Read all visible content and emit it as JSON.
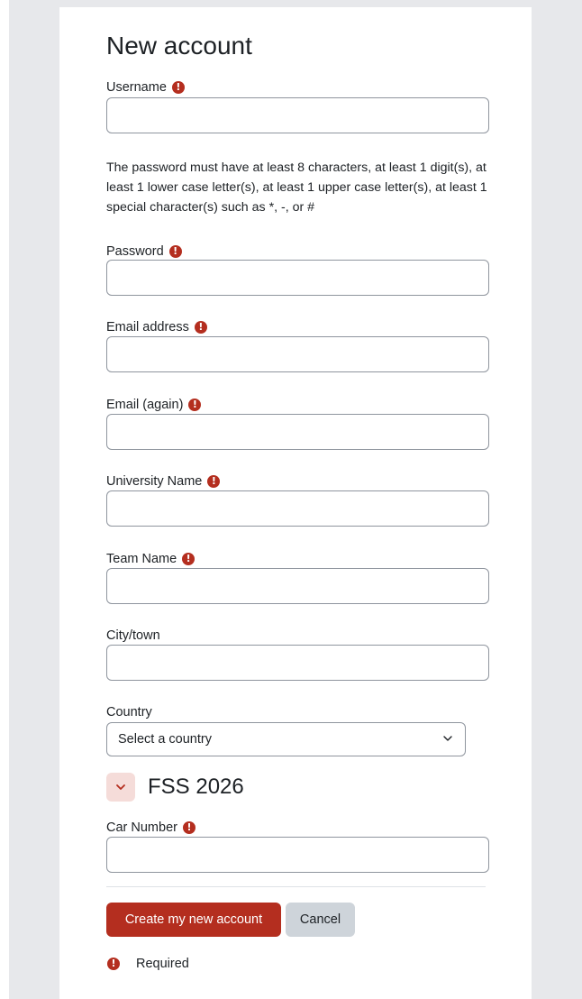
{
  "form": {
    "title": "New account",
    "password_policy": "The password must have at least 8 characters, at least 1 digit(s), at least 1 lower case letter(s), at least 1 upper case letter(s), at least 1 special character(s) such as *, -, or #",
    "fields": {
      "username": {
        "label": "Username",
        "required": true,
        "value": ""
      },
      "password": {
        "label": "Password",
        "required": true,
        "value": ""
      },
      "email": {
        "label": "Email address",
        "required": true,
        "value": ""
      },
      "email_again": {
        "label": "Email (again)",
        "required": true,
        "value": ""
      },
      "university": {
        "label": "University Name",
        "required": true,
        "value": ""
      },
      "team": {
        "label": "Team Name",
        "required": true,
        "value": ""
      },
      "city": {
        "label": "City/town",
        "required": false,
        "value": ""
      },
      "country": {
        "label": "Country",
        "required": false,
        "selected": "Select a country"
      },
      "car_number": {
        "label": "Car Number",
        "required": true,
        "value": ""
      }
    },
    "section": {
      "title": "FSS 2026",
      "expanded": true
    },
    "buttons": {
      "submit": "Create my new account",
      "cancel": "Cancel"
    },
    "legend": {
      "required_text": "Required"
    },
    "required_icon_glyph": "!"
  },
  "colors": {
    "accent": "#b42e1f",
    "accent_light": "#f5dcd9",
    "secondary_button": "#ced4da",
    "page_background": "#e7e8eb",
    "input_border": "#8f959e"
  },
  "icons": {
    "required": "exclamation-circle-icon",
    "select_arrow": "chevron-down-icon",
    "collapse": "chevron-down-icon"
  }
}
